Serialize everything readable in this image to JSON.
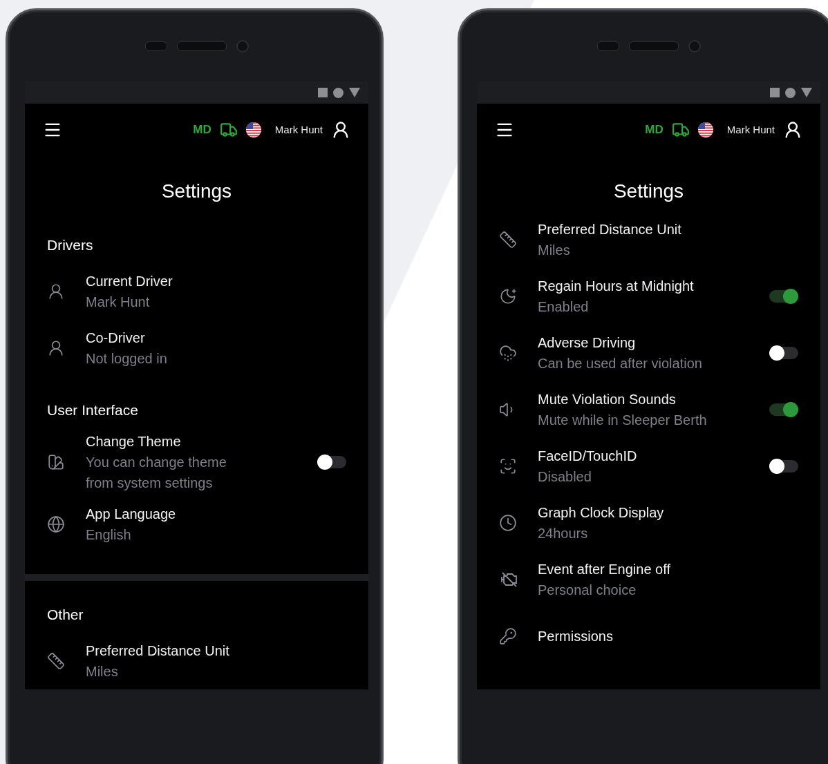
{
  "phones": [
    {
      "header": {
        "mode": "MD",
        "driver_name": "Mark Hunt"
      },
      "title": "Settings",
      "sections": [
        {
          "title": "Drivers",
          "items": [
            {
              "kind": "plain",
              "label": "Current Driver",
              "value": "Mark Hunt"
            },
            {
              "kind": "plain",
              "label": "Co-Driver",
              "value": "Not logged in"
            }
          ]
        },
        {
          "title": "User Interface",
          "items": [
            {
              "kind": "toggle",
              "label": "Change Theme",
              "value": "You can change theme from system settings",
              "on": false
            },
            {
              "kind": "plain",
              "label": "App Language",
              "value": "English"
            }
          ]
        },
        {
          "title": "Other",
          "items": [
            {
              "kind": "plain",
              "label": "Preferred Distance Unit",
              "value": "Miles"
            }
          ]
        }
      ]
    },
    {
      "header": {
        "mode": "MD",
        "driver_name": "Mark Hunt"
      },
      "title": "Settings",
      "sections": [
        {
          "items": [
            {
              "kind": "plain",
              "label": "Preferred Distance Unit",
              "value": "Miles"
            },
            {
              "kind": "toggle",
              "label": "Regain Hours at Midnight",
              "value": "Enabled",
              "on": true
            },
            {
              "kind": "toggle",
              "label": "Adverse Driving",
              "value": "Can be used after violation",
              "on": false
            },
            {
              "kind": "toggle",
              "label": "Mute Violation Sounds",
              "value": "Mute while in Sleeper Berth",
              "on": true
            },
            {
              "kind": "toggle",
              "label": "FaceID/TouchID",
              "value": "Disabled",
              "on": false
            },
            {
              "kind": "plain",
              "label": "Graph Clock Display",
              "value": "24hours"
            },
            {
              "kind": "plain",
              "label": "Event after Engine off",
              "value": "Personal choice"
            },
            {
              "kind": "plain",
              "label": "Permissions"
            }
          ]
        }
      ]
    }
  ]
}
